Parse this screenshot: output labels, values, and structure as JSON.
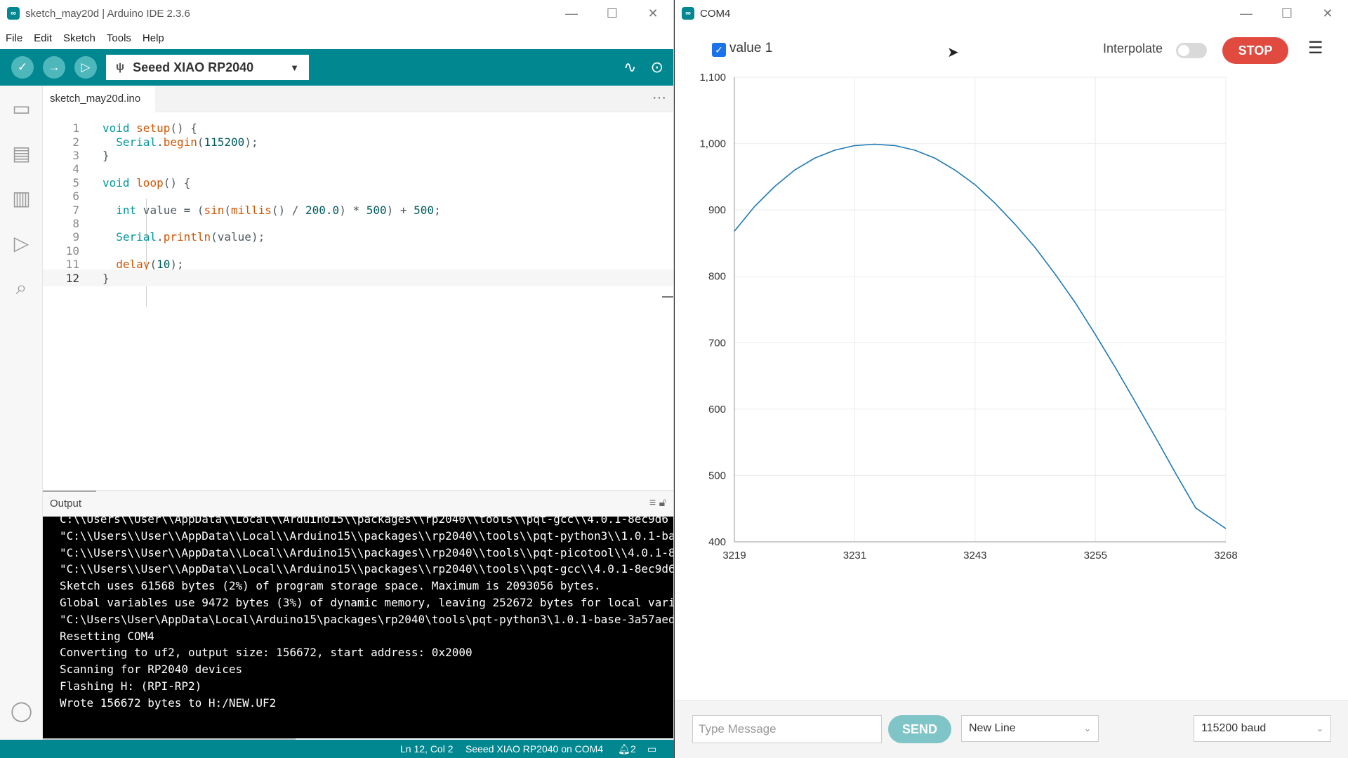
{
  "ide": {
    "title": "sketch_may20d | Arduino IDE 2.3.6",
    "menu": [
      "File",
      "Edit",
      "Sketch",
      "Tools",
      "Help"
    ],
    "board": "Seeed XIAO RP2040",
    "tab": "sketch_may20d.ino",
    "code": [
      {
        "n": "1",
        "html": "<span class='kw'>void</span> <span class='fn'>setup</span>() {"
      },
      {
        "n": "2",
        "html": "  <span class='kw'>Serial</span>.<span class='fn'>begin</span>(<span class='num'>115200</span>);"
      },
      {
        "n": "3",
        "html": "}"
      },
      {
        "n": "4",
        "html": ""
      },
      {
        "n": "5",
        "html": "<span class='kw'>void</span> <span class='fn'>loop</span>() {"
      },
      {
        "n": "6",
        "html": ""
      },
      {
        "n": "7",
        "html": "  <span class='kw'>int</span> value = (<span class='fn'>sin</span>(<span class='fn'>millis</span>() / <span class='num'>200.0</span>) * <span class='num'>500</span>) + <span class='num'>500</span>;"
      },
      {
        "n": "8",
        "html": ""
      },
      {
        "n": "9",
        "html": "  <span class='kw'>Serial</span>.<span class='fn'>println</span>(value);"
      },
      {
        "n": "10",
        "html": ""
      },
      {
        "n": "11",
        "html": "  <span class='fn'>delay</span>(<span class='num'>10</span>);"
      },
      {
        "n": "12",
        "html": "}"
      }
    ],
    "output_label": "Output",
    "console": [
      "C:\\\\Users\\\\User\\\\AppData\\\\Local\\\\Arduino15\\\\packages\\\\rp2040\\\\tools\\\\pqt-gcc\\\\4.0.1-8ec9d6",
      "\"C:\\\\Users\\\\User\\\\AppData\\\\Local\\\\Arduino15\\\\packages\\\\rp2040\\\\tools\\\\pqt-python3\\\\1.0.1-ba",
      "\"C:\\\\Users\\\\User\\\\AppData\\\\Local\\\\Arduino15\\\\packages\\\\rp2040\\\\tools\\\\pqt-picotool\\\\4.0.1-8",
      "\"C:\\\\Users\\\\User\\\\AppData\\\\Local\\\\Arduino15\\\\packages\\\\rp2040\\\\tools\\\\pqt-gcc\\\\4.0.1-8ec9d6",
      "Sketch uses 61568 bytes (2%) of program storage space. Maximum is 2093056 bytes.",
      "Global variables use 9472 bytes (3%) of dynamic memory, leaving 252672 bytes for local vari",
      "\"C:\\Users\\User\\AppData\\Local\\Arduino15\\packages\\rp2040\\tools\\pqt-python3\\1.0.1-base-3a57aed",
      "Resetting COM4",
      "Converting to uf2, output size: 156672, start address: 0x2000",
      "Scanning for RP2040 devices",
      "Flashing H: (RPI-RP2)",
      "Wrote 156672 bytes to H:/NEW.UF2"
    ],
    "status": {
      "position": "Ln 12, Col 2",
      "board_port": "Seeed XIAO RP2040 on COM4",
      "notifications": "2"
    }
  },
  "plotter": {
    "title": "COM4",
    "series_label": "value 1",
    "interpolate_label": "Interpolate",
    "stop_label": "STOP",
    "message_placeholder": "Type Message",
    "send_label": "SEND",
    "line_ending": "New Line",
    "baud": "115200 baud",
    "colors": {
      "line": "#1f78b4",
      "accent": "#00878f",
      "stop": "#e04a3f"
    }
  },
  "chart_data": {
    "type": "line",
    "title": "",
    "xlabel": "",
    "ylabel": "",
    "xlim": [
      3219,
      3268
    ],
    "ylim": [
      400,
      1100
    ],
    "x_ticks": [
      3219,
      3231,
      3243,
      3255,
      3268
    ],
    "y_ticks": [
      1100,
      1000,
      900,
      800,
      700,
      600,
      500,
      400
    ],
    "y_tick_labels": [
      "1,100",
      "1,000",
      "900",
      "800",
      "700",
      "600",
      "500",
      "400"
    ],
    "grid": true,
    "series": [
      {
        "name": "value 1",
        "x": [
          3219,
          3221,
          3223,
          3225,
          3227,
          3229,
          3231,
          3233,
          3235,
          3237,
          3239,
          3241,
          3243,
          3245,
          3247,
          3249,
          3251,
          3253,
          3255,
          3257,
          3259,
          3261,
          3263,
          3265,
          3268
        ],
        "y": [
          868,
          905,
          935,
          960,
          978,
          990,
          997,
          999,
          997,
          990,
          978,
          960,
          938,
          910,
          878,
          843,
          803,
          760,
          712,
          662,
          610,
          557,
          503,
          451,
          420
        ]
      }
    ]
  }
}
